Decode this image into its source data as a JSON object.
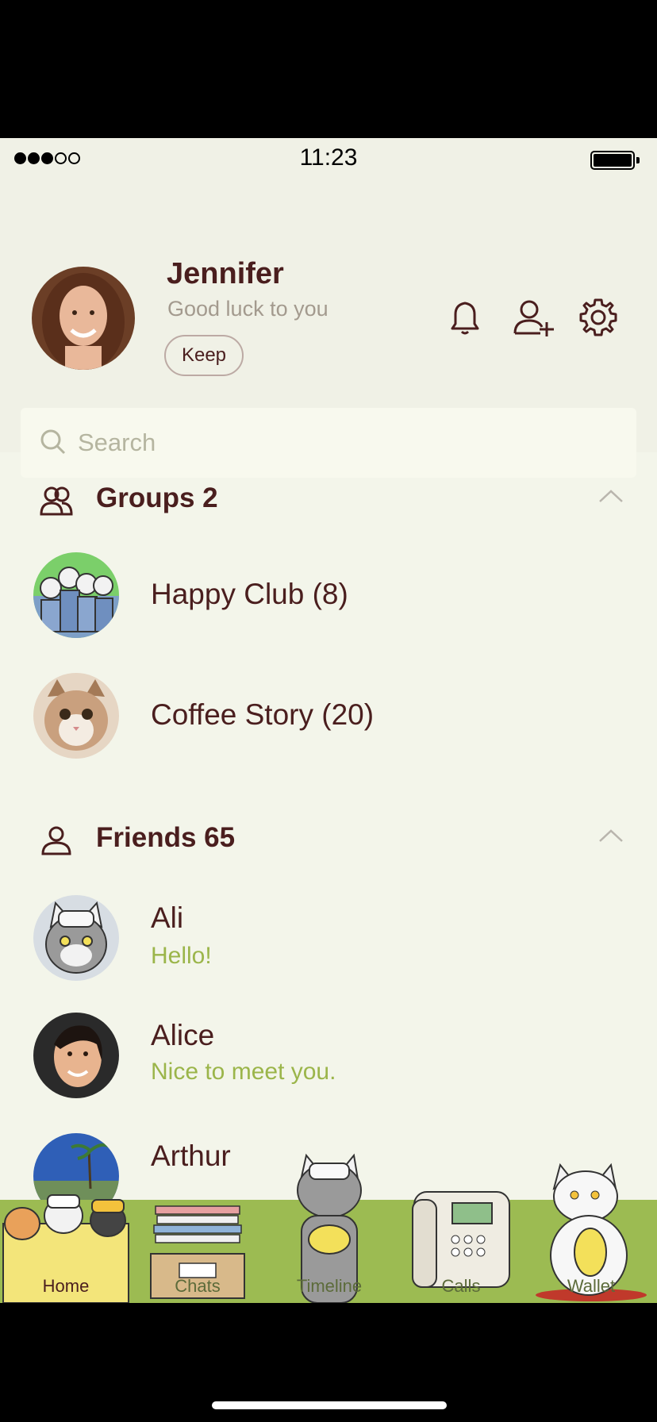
{
  "status_bar": {
    "time": "11:23",
    "signal_bars_filled": 3,
    "signal_bars_total": 5,
    "battery_level": 1.0
  },
  "profile": {
    "name": "Jennifer",
    "status_message": "Good luck to you",
    "keep_label": "Keep"
  },
  "header_icons": [
    "bell-icon",
    "add-friend-icon",
    "gear-icon"
  ],
  "search": {
    "placeholder": "Search"
  },
  "groups": {
    "title": "Groups 2",
    "items": [
      {
        "name": "Happy Club (8)"
      },
      {
        "name": "Coffee Story (20)"
      }
    ]
  },
  "friends": {
    "title": "Friends 65",
    "items": [
      {
        "name": "Ali",
        "status": "Hello!"
      },
      {
        "name": "Alice",
        "status": "Nice to meet you."
      },
      {
        "name": "Arthur",
        "status": ""
      }
    ]
  },
  "tabs": [
    {
      "label": "Home",
      "active": true
    },
    {
      "label": "Chats",
      "active": false
    },
    {
      "label": "Timeline",
      "active": false
    },
    {
      "label": "Calls",
      "active": false
    },
    {
      "label": "Wallet",
      "active": false
    }
  ],
  "colors": {
    "background": "#f3f5ea",
    "header": "#f0f1e6",
    "text_primary": "#4a1e1e",
    "text_status": "#9bb54a",
    "tabbar": "#9cbb52"
  }
}
